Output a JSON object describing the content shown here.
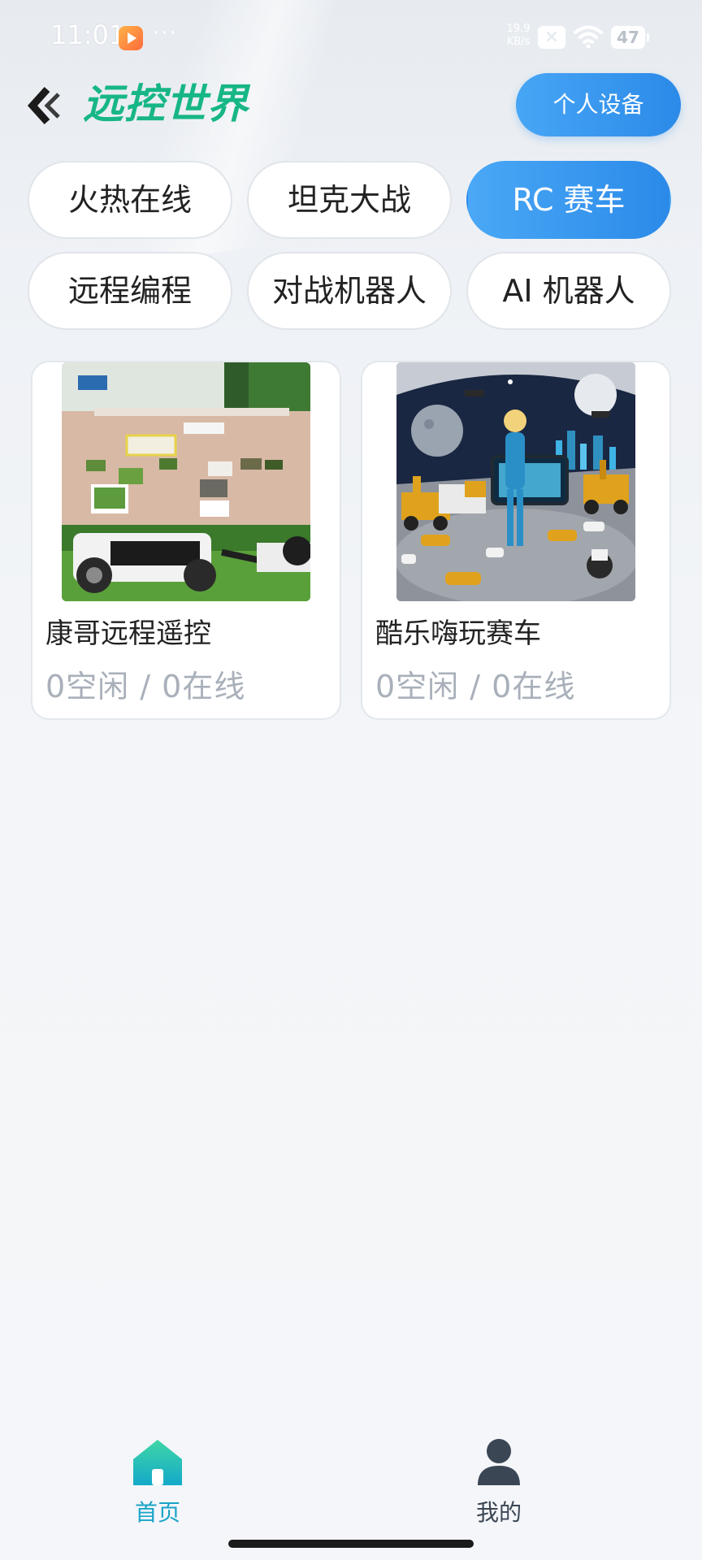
{
  "status_bar": {
    "time": "11:01",
    "dots": "···",
    "net_speed_value": "19.9",
    "net_speed_unit": "KB/s",
    "sim_icon": "sim-off-icon",
    "wifi_icon": "wifi-icon",
    "battery": "47"
  },
  "header": {
    "title": "远控世界",
    "device_button": "个人设备",
    "back_icon": "chevron-left-icon"
  },
  "categories": [
    {
      "label": "火热在线",
      "active": false
    },
    {
      "label": "坦克大战",
      "active": false
    },
    {
      "label": "RC 赛车",
      "active": true
    },
    {
      "label": "远程编程",
      "active": false
    },
    {
      "label": "对战机器人",
      "active": false
    },
    {
      "label": "AI 机器人",
      "active": false
    }
  ],
  "cards": [
    {
      "title": "康哥远程遥控",
      "status": "0空闲 / 0在线",
      "image": "rc-tank-arena-photo"
    },
    {
      "title": "酷乐嗨玩赛车",
      "status": "0空闲 / 0在线",
      "image": "moon-racing-illustration"
    }
  ],
  "bottom_nav": {
    "items": [
      {
        "label": "首页",
        "icon": "home-icon",
        "active": true
      },
      {
        "label": "我的",
        "icon": "user-icon",
        "active": false
      }
    ]
  },
  "colors": {
    "accent": "#2b8ae8",
    "title_green": "#17b686",
    "nav_active": "#1aa3c8",
    "nav_inactive": "#3b4654",
    "muted_text": "#a9b0ba"
  }
}
